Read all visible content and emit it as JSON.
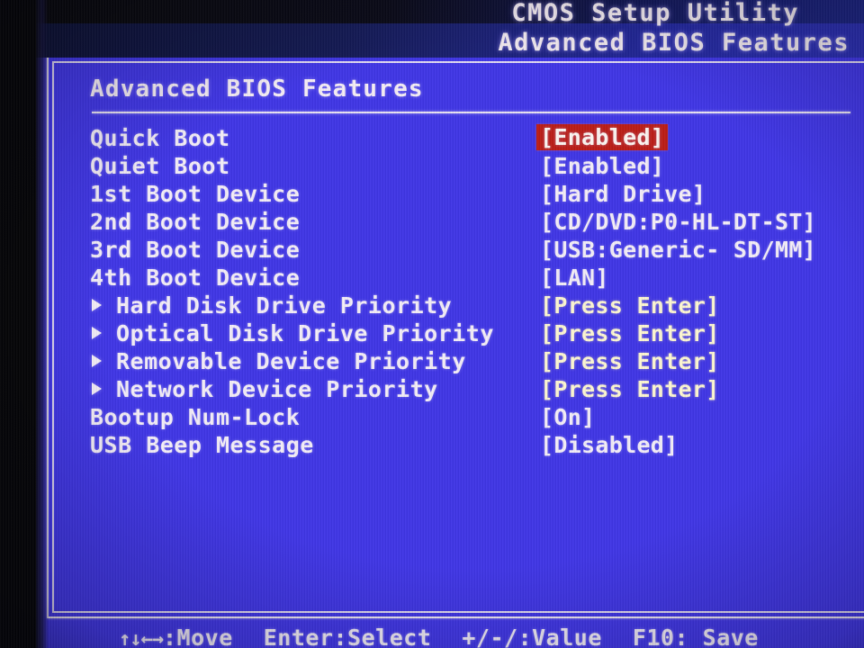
{
  "screen": {
    "background_color": "#4036e6",
    "text_color": "#f4eef8",
    "highlight_color": "#bc1d16"
  },
  "titlebar": {
    "utility_title": "CMOS Setup Utility",
    "section_title": "Advanced BIOS Features"
  },
  "page": {
    "heading": "Advanced BIOS Features"
  },
  "options": [
    {
      "label": "Quick Boot",
      "value": "[Enabled]",
      "submenu": false,
      "selected": true,
      "warm": false
    },
    {
      "label": "Quiet Boot",
      "value": "[Enabled]",
      "submenu": false,
      "selected": false,
      "warm": false
    },
    {
      "label": "1st Boot Device",
      "value": "[Hard Drive]",
      "submenu": false,
      "selected": false,
      "warm": false
    },
    {
      "label": "2nd Boot Device",
      "value": "[CD/DVD:P0-HL-DT-ST]",
      "submenu": false,
      "selected": false,
      "warm": false
    },
    {
      "label": "3rd Boot Device",
      "value": "[USB:Generic- SD/MM]",
      "submenu": false,
      "selected": false,
      "warm": false
    },
    {
      "label": "4th Boot Device",
      "value": "[LAN]",
      "submenu": false,
      "selected": false,
      "warm": false
    },
    {
      "label": "Hard Disk Drive Priority",
      "value": "[Press Enter]",
      "submenu": true,
      "selected": false,
      "warm": true
    },
    {
      "label": "Optical Disk Drive Priority",
      "value": "[Press Enter]",
      "submenu": true,
      "selected": false,
      "warm": true
    },
    {
      "label": "Removable Device Priority",
      "value": "[Press Enter]",
      "submenu": true,
      "selected": false,
      "warm": true
    },
    {
      "label": "Network Device Priority",
      "value": "[Press Enter]",
      "submenu": true,
      "selected": false,
      "warm": true
    },
    {
      "label": "Bootup Num-Lock",
      "value": "[On]",
      "submenu": false,
      "selected": false,
      "warm": false
    },
    {
      "label": "USB Beep Message",
      "value": "[Disabled]",
      "submenu": false,
      "selected": false,
      "warm": false
    }
  ],
  "footer": {
    "keys": [
      {
        "arrows": "↑↓←→",
        "text": ":Move"
      },
      {
        "arrows": "",
        "text": "Enter:Select"
      },
      {
        "arrows": "",
        "text": "+/-/:Value"
      },
      {
        "arrows": "",
        "text": "F10: Save"
      }
    ]
  }
}
